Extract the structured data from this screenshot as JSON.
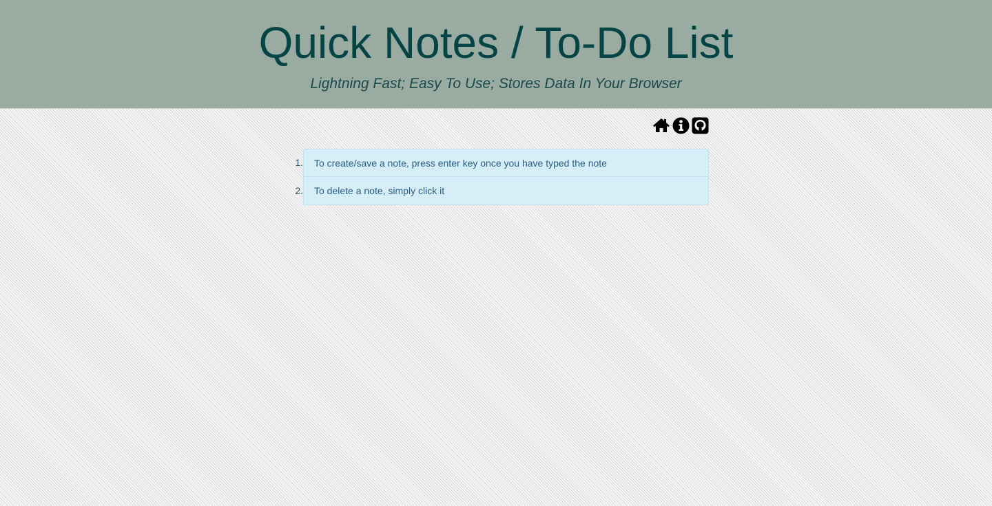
{
  "header": {
    "title": "Quick Notes / To-Do List",
    "subtitle": "Lightning Fast; Easy To Use; Stores Data In Your Browser"
  },
  "toolbar": {
    "icons": [
      "home-icon",
      "info-icon",
      "github-icon"
    ]
  },
  "notes": [
    {
      "number": "1.",
      "text": "To create/save a note, press enter key once you have typed the note"
    },
    {
      "number": "2.",
      "text": "To delete a note, simply click it"
    }
  ],
  "colors": {
    "header_bg": "#9aaba2",
    "title": "#044444",
    "note_bg": "#d6eef7",
    "note_text": "#2a5d84"
  }
}
